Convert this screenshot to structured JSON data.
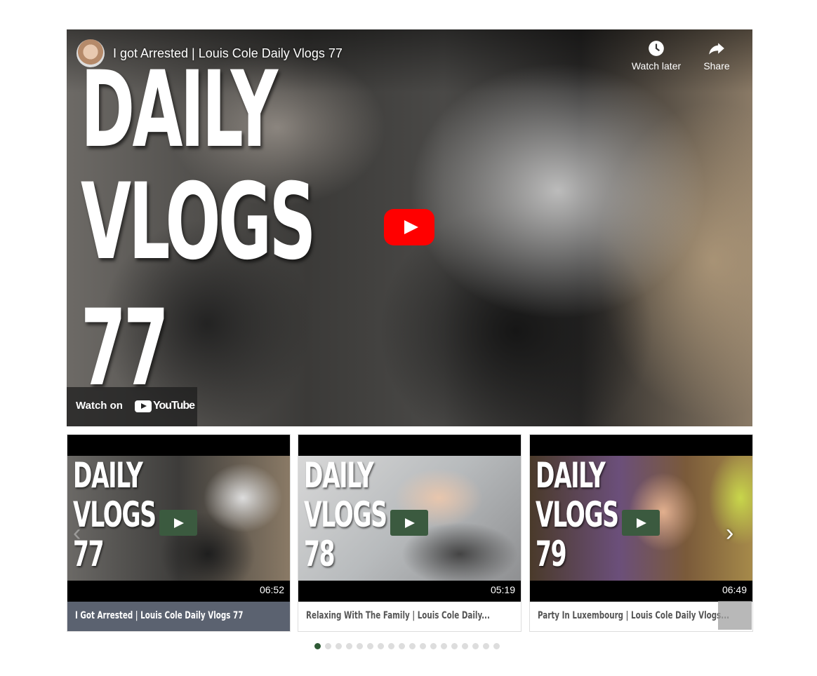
{
  "player": {
    "title": "I got Arrested | Louis Cole Daily Vlogs 77",
    "overlay_line1": "DAILY",
    "overlay_line2": "VLOGS",
    "overlay_line3": "77",
    "watch_later_label": "Watch later",
    "share_label": "Share",
    "watch_on_label": "Watch on",
    "youtube_label": "YouTube",
    "play_icon": "youtube-play-icon",
    "youtube_red": "#ff0000"
  },
  "carousel": {
    "accent": "#2f5a36",
    "cards": [
      {
        "line1": "DAILY",
        "line2": "VLOGS",
        "line3": "77",
        "duration": "06:52",
        "caption": "I Got Arrested | Louis Cole Daily Vlogs 77"
      },
      {
        "line1": "DAILY",
        "line2": "VLOGS",
        "line3": "78",
        "duration": "05:19",
        "caption": "Relaxing With The Family | Louis Cole Daily..."
      },
      {
        "line1": "DAILY",
        "line2": "VLOGS",
        "line3": "79",
        "duration": "06:49",
        "caption": "Party In Luxembourg | Louis Cole Daily Vlogs..."
      }
    ],
    "prev_arrow": "‹",
    "next_arrow": "›",
    "page_count": 18,
    "active_page": 1
  }
}
